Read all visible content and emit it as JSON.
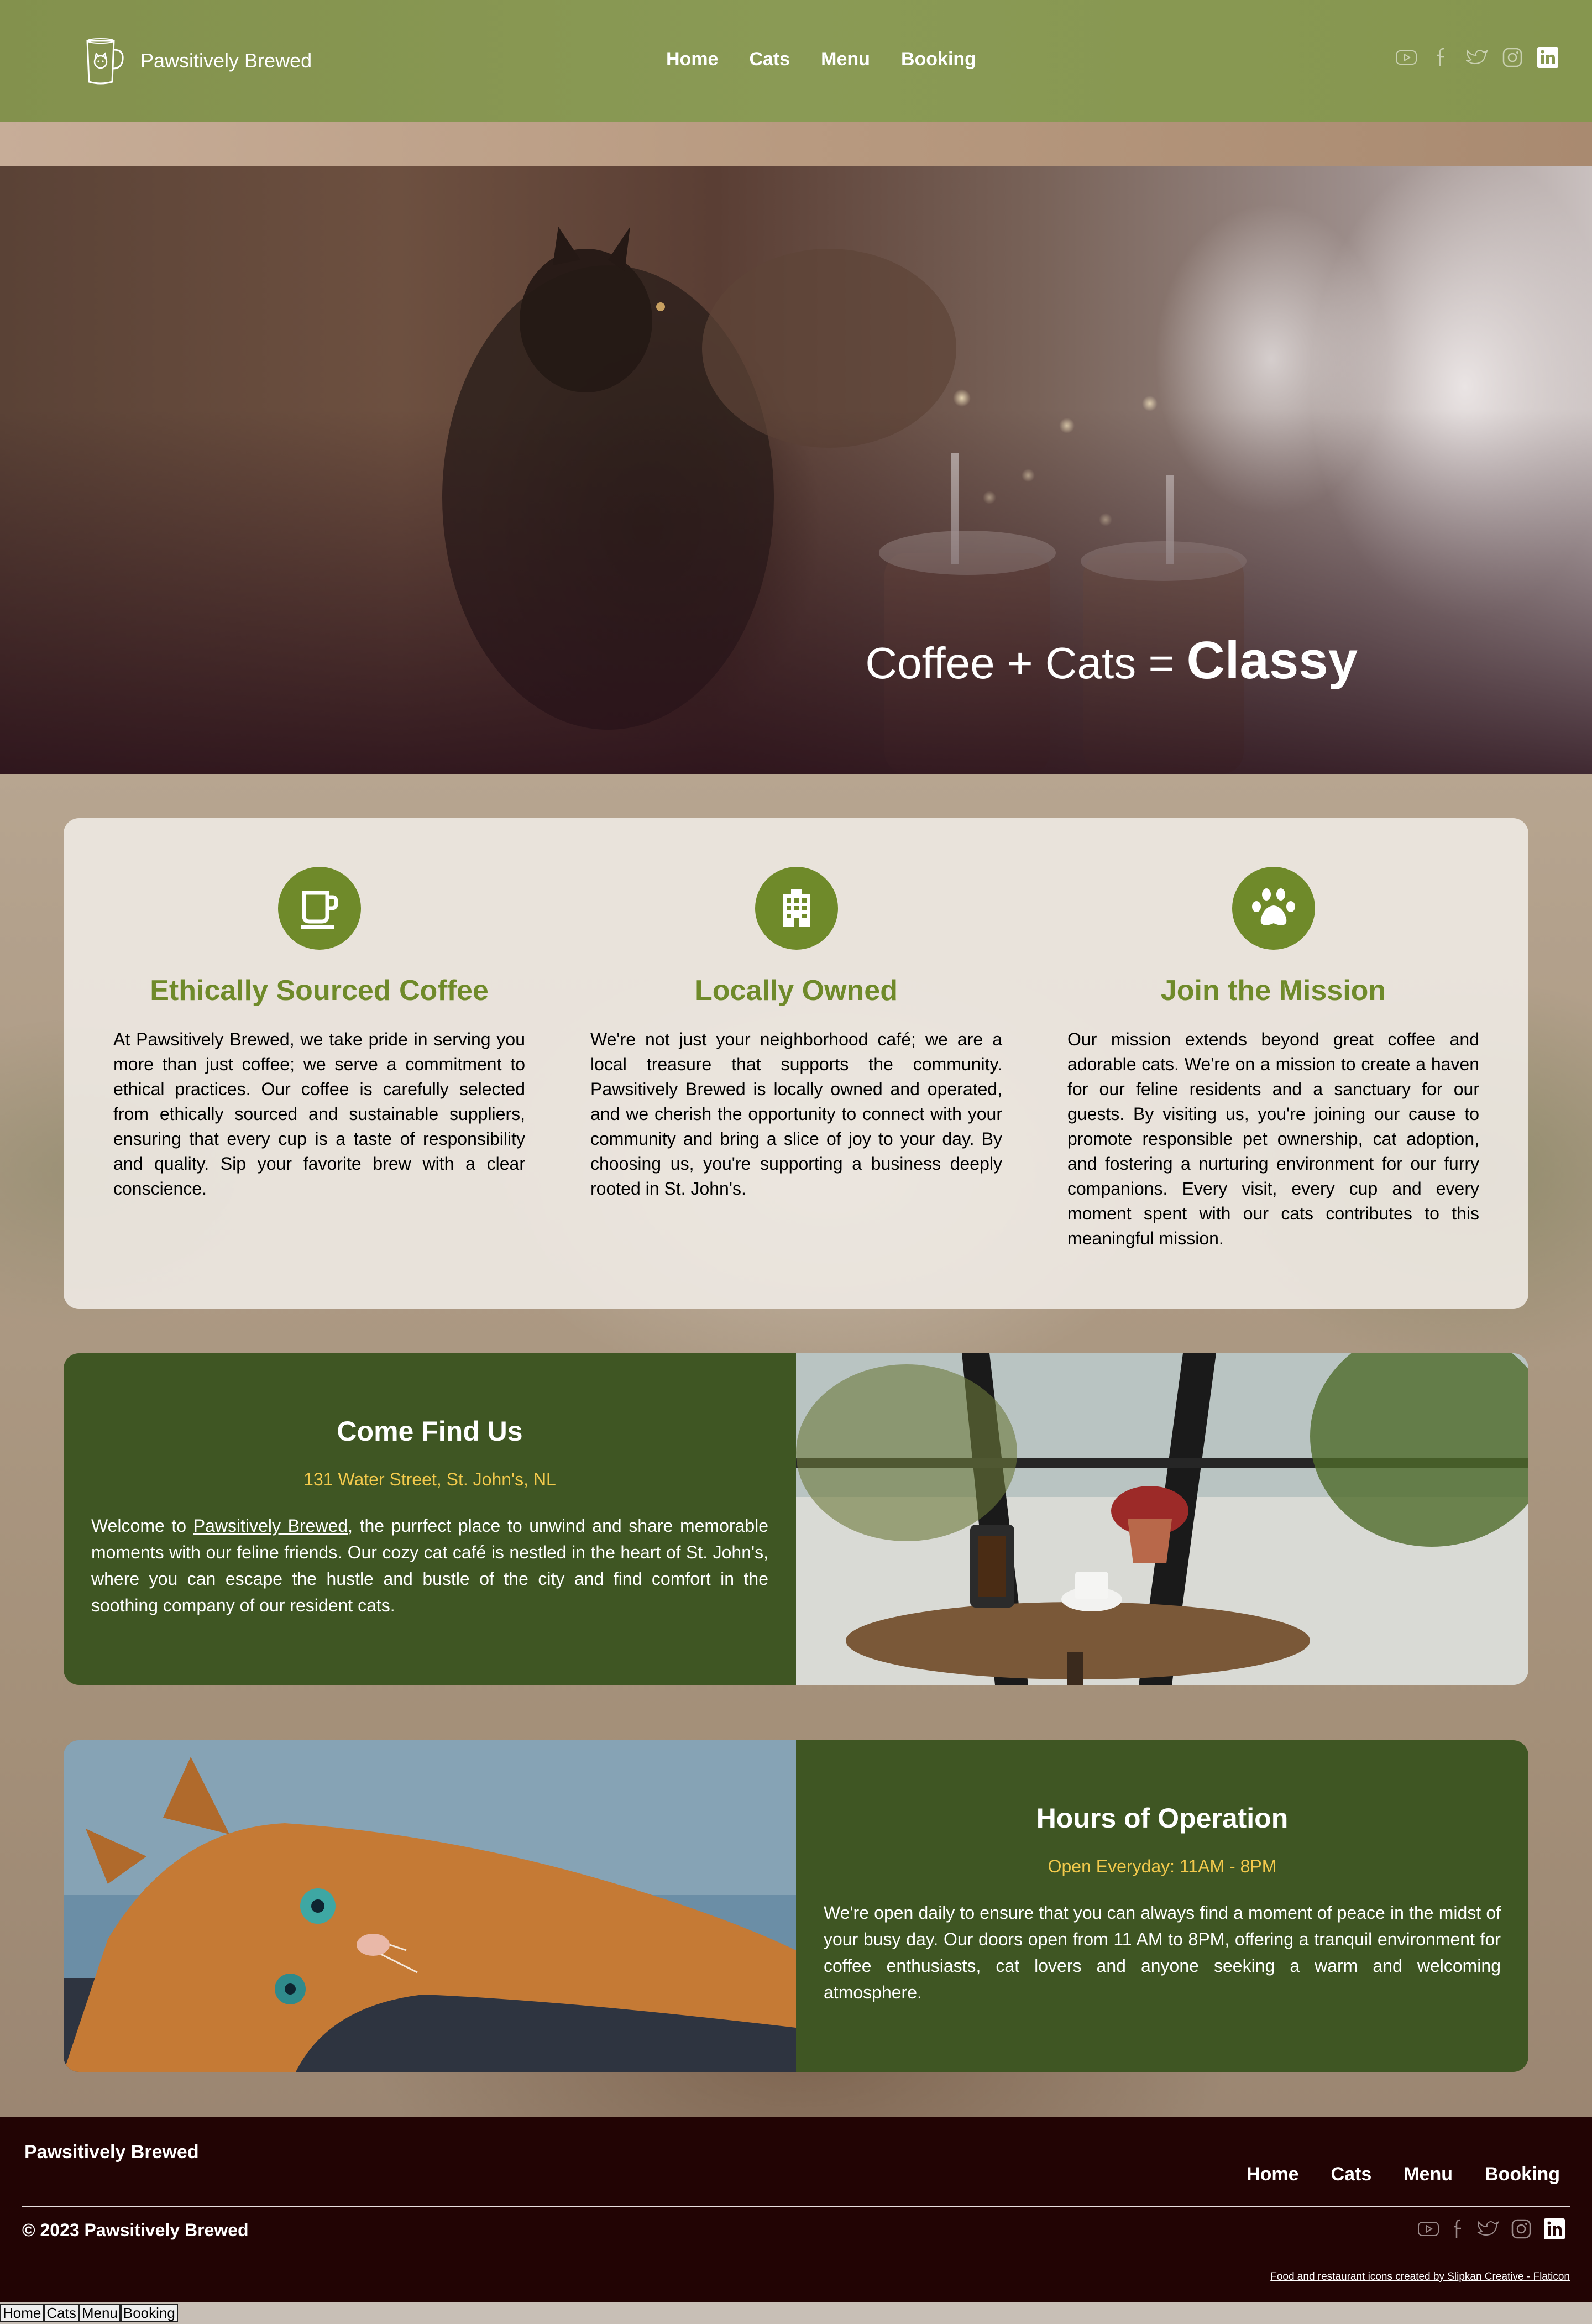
{
  "header": {
    "brand_name": "Pawsitively Brewed",
    "nav": [
      "Home",
      "Cats",
      "Menu",
      "Booking"
    ],
    "social_icons": [
      "youtube-icon",
      "facebook-icon",
      "twitter-icon",
      "instagram-icon",
      "linkedin-icon"
    ]
  },
  "hero": {
    "title_light": "Coffee + Cats = ",
    "title_bold": "Classy"
  },
  "features": [
    {
      "icon": "coffee-cup-icon",
      "title": "Ethically Sourced Coffee",
      "text": "At Pawsitively Brewed, we take pride in serving you more than just coffee; we serve a commitment to ethical practices. Our coffee is carefully selected from ethically sourced and sustainable suppliers, ensuring that every cup is a taste of responsibility and quality. Sip your favorite brew with a clear conscience."
    },
    {
      "icon": "building-icon",
      "title": "Locally Owned",
      "text": "We're not just your neighborhood café; we are a local treasure that supports the community. Pawsitively Brewed is locally owned and operated, and we cherish the opportunity to connect with your community and bring a slice of joy to your day. By choosing us, you're supporting a business deeply rooted in St. John's."
    },
    {
      "icon": "paw-icon",
      "title": "Join the Mission",
      "text": "Our mission extends beyond great coffee and adorable cats. We're on a mission to create a haven for our feline residents and a sanctuary for our guests. By visiting us, you're joining our cause to promote responsible pet ownership, cat adoption, and fostering a nurturing environment for our furry companions. Every visit, every cup and every moment spent with our cats contributes to this meaningful mission."
    }
  ],
  "find_us": {
    "title": "Come Find Us",
    "address": "131 Water Street, St. John's, NL",
    "text_before": "Welcome to ",
    "link": "Pawsitively Brewed",
    "text_after": ", the purrfect place to unwind and share memorable moments with our feline friends. Our cozy cat café is nestled in the heart of St. John's, where you can escape the hustle and bustle of the city and find comfort in the soothing company of our resident cats."
  },
  "hours": {
    "title": "Hours of Operation",
    "subtitle": "Open Everyday: 11AM - 8PM",
    "text": "We're open daily to ensure that you can always find a moment of peace in the midst of your busy day. Our doors open from 11 AM to 8PM, offering a tranquil environment for coffee enthusiasts, cat lovers and anyone seeking a warm and welcoming atmosphere."
  },
  "footer": {
    "brand": "Pawsitively Brewed",
    "nav": [
      "Home",
      "Cats",
      "Menu",
      "Booking"
    ],
    "copyright": "© 2023 Pawsitively Brewed",
    "credit": "Food and restaurant icons created by Slipkan Creative - Flaticon"
  },
  "bottom_links": [
    "Home",
    "Cats",
    "Menu",
    "Booking"
  ],
  "colors": {
    "header_green": "#86964f",
    "accent_green": "#6f8a2a",
    "block_green": "#3f5623",
    "highlight_yellow": "#f2c94c",
    "footer_bg": "#220404"
  }
}
